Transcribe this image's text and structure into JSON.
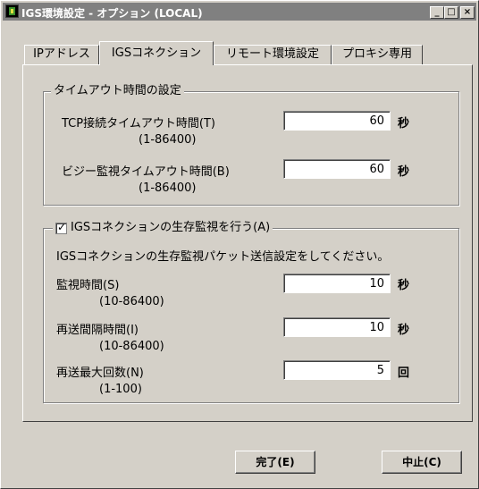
{
  "window": {
    "title": "IGS環境設定 - オプション (LOCAL)",
    "minimize": "_",
    "maximize": "□",
    "close": "×"
  },
  "tabs": [
    {
      "label": "IPアドレス",
      "active": false
    },
    {
      "label": "IGSコネクション",
      "active": true
    },
    {
      "label": "リモート環境設定",
      "active": false
    },
    {
      "label": "プロキシ専用",
      "active": false
    }
  ],
  "timeout_group": {
    "legend": "タイムアウト時間の設定",
    "tcp": {
      "label": "TCP接続タイムアウト時間(T)",
      "range": "(1-86400)",
      "value": "60",
      "unit": "秒"
    },
    "busy": {
      "label": "ビジー監視タイムアウト時間(B)",
      "range": "(1-86400)",
      "value": "60",
      "unit": "秒"
    }
  },
  "live_group": {
    "legend": "IGSコネクションの生存監視を行う(A)",
    "checked": true,
    "description": "IGSコネクションの生存監視パケット送信設定をしてください。",
    "monitor": {
      "label": "監視時間(S)",
      "range": "(10-86400)",
      "value": "10",
      "unit": "秒"
    },
    "resend_interval": {
      "label": "再送間隔時間(I)",
      "range": "(10-86400)",
      "value": "10",
      "unit": "秒"
    },
    "resend_max": {
      "label": "再送最大回数(N)",
      "range": "(1-100)",
      "value": "5",
      "unit": "回"
    }
  },
  "buttons": {
    "done": "完了(E)",
    "cancel": "中止(C)"
  }
}
